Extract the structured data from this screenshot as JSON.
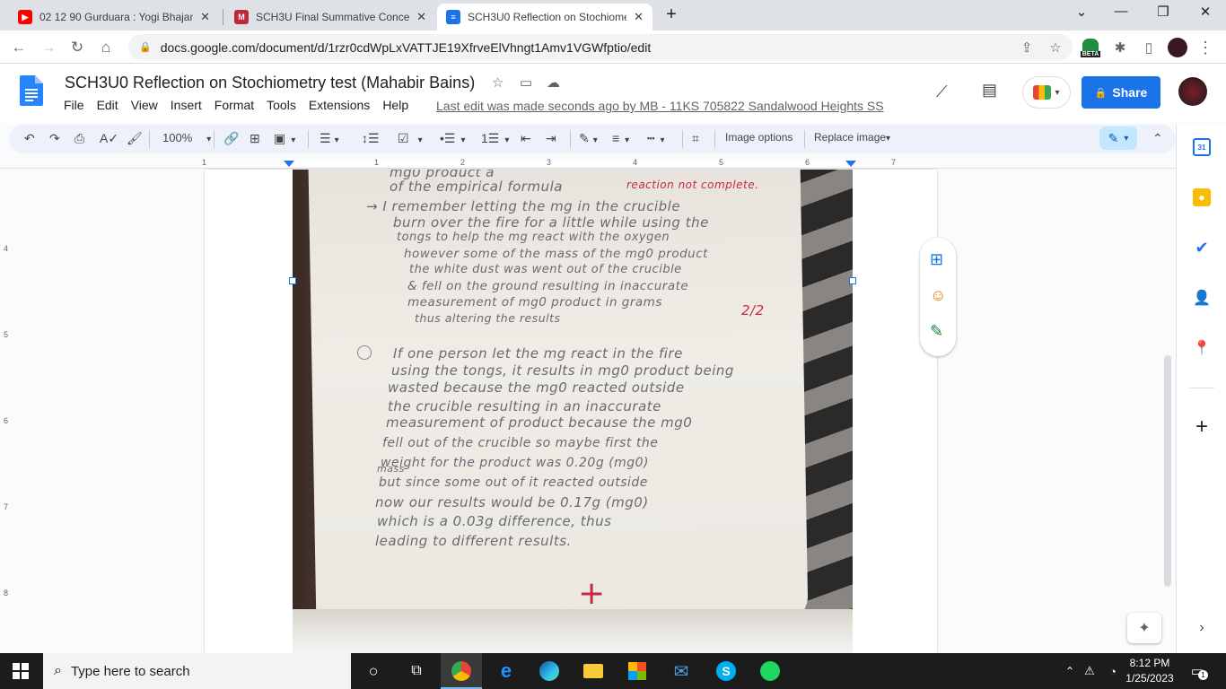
{
  "tabs": [
    {
      "title": "02 12 90 Gurduara : Yogi Bhajan |",
      "icon": "youtube-icon",
      "color": "#ff0000"
    },
    {
      "title": "SCH3U Final Summative Concept",
      "icon": "brand-icon",
      "color": "#c0283a"
    },
    {
      "title": "SCH3U0 Reflection on Stochiome",
      "icon": "docs-icon",
      "color": "#1a73e8"
    }
  ],
  "address": {
    "url": "docs.google.com/document/d/1rzr0cdWpLxVATTJE19XfrveElVhngt1Amv1VGWfptio/edit",
    "beta_label": "BETA"
  },
  "doc": {
    "title": "SCH3U0 Reflection on Stochiometry test (Mahabir Bains)",
    "menus": [
      "File",
      "Edit",
      "View",
      "Insert",
      "Format",
      "Tools",
      "Extensions",
      "Help"
    ],
    "last_edit": "Last edit was made seconds ago by MB - 11KS 705822 Sandalwood Heights SS",
    "share_label": "Share"
  },
  "toolbar": {
    "zoom": "100%",
    "image_options": "Image options",
    "replace_image": "Replace image"
  },
  "ruler": {
    "h": [
      "1",
      "1",
      "2",
      "3",
      "4",
      "5",
      "6",
      "7"
    ],
    "v": [
      "4",
      "5",
      "6",
      "7",
      "8"
    ]
  },
  "handwriting": [
    "mg0 product a",
    "of the empirical formula",
    "→ I remember letting the mg in the crucible",
    "burn over the fire for a little while using the",
    "tongs to help the mg react with the oxygen",
    "however some of the mass of the mg0 product",
    "the white dust was went out of the crucible",
    "& fell on the ground resulting in inaccurate",
    "measurement of mg0 product in grams",
    "thus altering the results",
    "If one person let the mg react in the fire",
    "using the tongs, it results in mg0 product being",
    "wasted because the mg0 reacted outside",
    "the crucible resulting in an inaccurate",
    "measurement of product because the mg0",
    "fell out of the crucible so maybe first the",
    "weight for the product was 0.20g (mg0)",
    "mass",
    "but since some out of it reacted outside",
    "now our results would be 0.17g (mg0)",
    "which is a 0.03g difference, thus",
    "leading to different results."
  ],
  "annotations": {
    "note": "reaction not complete.",
    "score": "2/2",
    "mark": "+"
  },
  "taskbar": {
    "search_placeholder": "Type here to search",
    "time": "8:12 PM",
    "date": "1/25/2023",
    "notifications": "1"
  }
}
